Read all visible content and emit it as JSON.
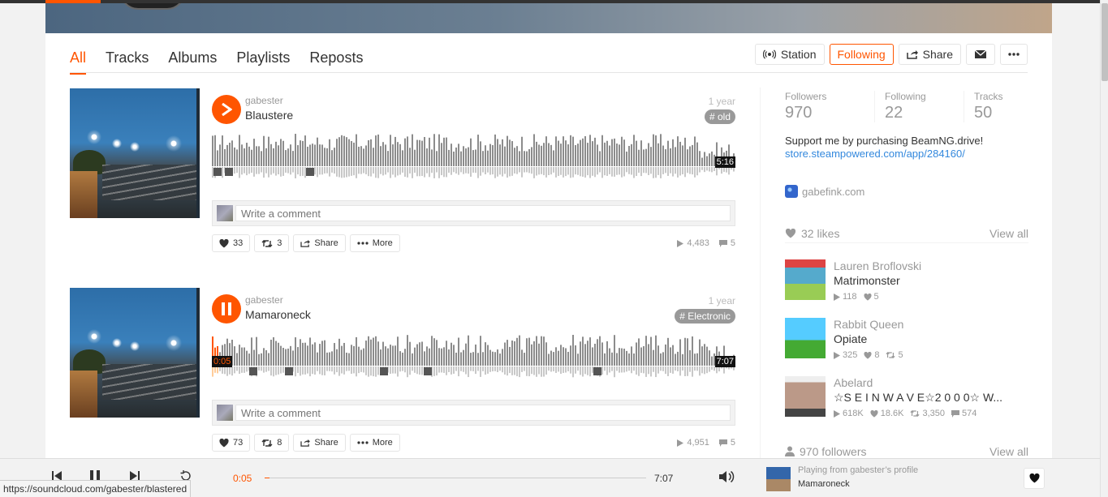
{
  "tabs": [
    "All",
    "Tracks",
    "Albums",
    "Playlists",
    "Reposts"
  ],
  "actions": {
    "station": "Station",
    "following": "Following",
    "share": "Share"
  },
  "tracks": [
    {
      "uploader": "gabester",
      "title": "Blaustere",
      "age": "1 year",
      "tag": "# old",
      "duration": "5:16",
      "comment_placeholder": "Write a comment",
      "likes": "33",
      "reposts": "3",
      "share": "Share",
      "more": "More",
      "plays": "4,483",
      "comments": "5",
      "progress": 0,
      "playing": false
    },
    {
      "uploader": "gabester",
      "title": "Mamaroneck",
      "age": "1 year",
      "tag": "# Electronic",
      "duration": "7:07",
      "current": "0:05",
      "comment_placeholder": "Write a comment",
      "likes": "73",
      "reposts": "8",
      "share": "Share",
      "more": "More",
      "plays": "4,951",
      "comments": "5",
      "progress": 0.012,
      "playing": true
    }
  ],
  "sidebar": {
    "counts": [
      {
        "label": "Followers",
        "value": "970"
      },
      {
        "label": "Following",
        "value": "22"
      },
      {
        "label": "Tracks",
        "value": "50"
      }
    ],
    "bio_text": "Support me by purchasing BeamNG.drive!",
    "bio_link": "store.steampowered.com/app/284160/",
    "website": "gabefink.com",
    "likes_header": "32 likes",
    "view_all": "View all",
    "likes": [
      {
        "artist": "Lauren Broflovski",
        "title": "Matrimonster",
        "plays": "118",
        "likes": "5"
      },
      {
        "artist": "Rabbit Queen",
        "title": "Opiate",
        "plays": "325",
        "likes": "8",
        "reposts": "5"
      },
      {
        "artist": "Abelard",
        "title": "☆S E I N W A V E☆2 0 0 0☆ W...",
        "plays": "618K",
        "likes": "18.6K",
        "reposts": "3,350",
        "comments": "574"
      }
    ],
    "followers_header": "970 followers"
  },
  "player": {
    "current": "0:05",
    "duration": "7:07",
    "progress": 0.012,
    "from": "Playing from gabester’s profile",
    "title": "Mamaroneck"
  },
  "status_url": "https://soundcloud.com/gabester/blastered",
  "colors": {
    "accent": "#ff5500",
    "wave": "#999999",
    "link": "#3388dd"
  }
}
